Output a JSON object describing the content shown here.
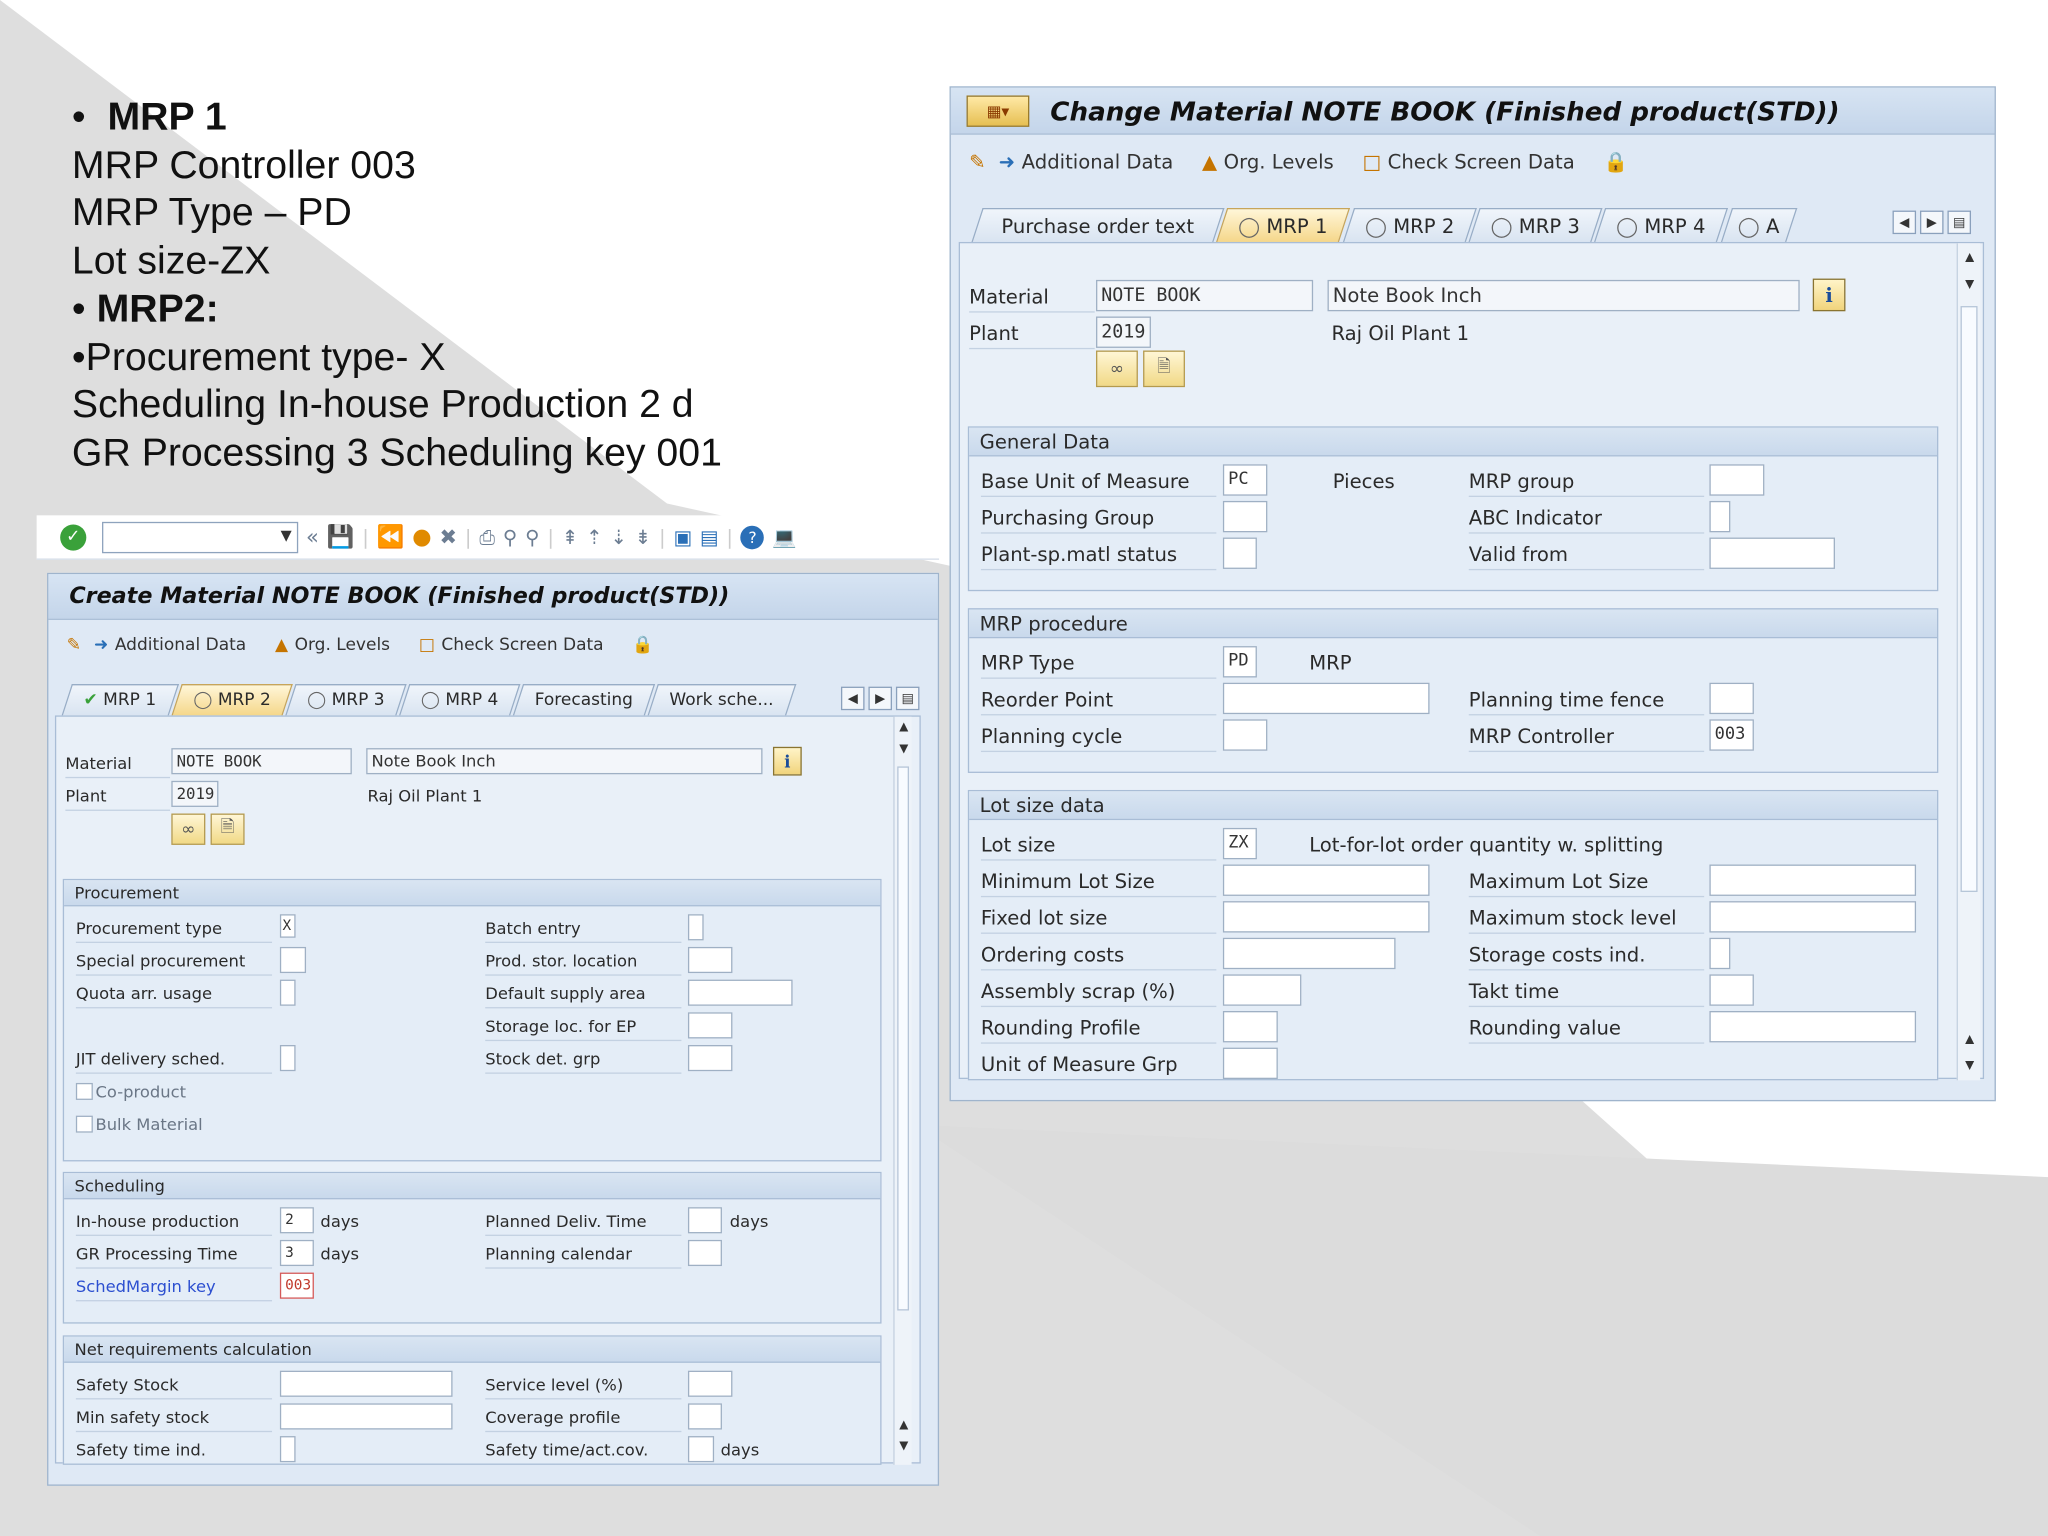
{
  "notes": {
    "line1": "MRP 1",
    "line2": "MRP Controller 003",
    "line3": "MRP Type – PD",
    "line4": "Lot size-ZX",
    "line5": "MRP2:",
    "line6": "•Procurement type- X",
    "line7": "Scheduling In-house Production 2 d",
    "line8": "GR Processing 3 Scheduling key 001"
  },
  "create_window": {
    "title": "Create Material NOTE BOOK (Finished product(STD))",
    "appbar": [
      "Additional Data",
      "Org. Levels",
      "Check Screen Data"
    ],
    "tabs": [
      "MRP 1",
      "MRP 2",
      "MRP 3",
      "MRP 4",
      "Forecasting",
      "Work sche..."
    ],
    "active_tab": "MRP 2",
    "header": {
      "material_label": "Material",
      "material_value": "NOTE BOOK",
      "material_desc": "Note Book Inch",
      "plant_label": "Plant",
      "plant_value": "2019",
      "plant_desc": "Raj Oil Plant 1"
    },
    "procurement": {
      "title": "Procurement",
      "procurement_type_label": "Procurement type",
      "procurement_type_value": "X",
      "special_procurement_label": "Special procurement",
      "quota_label": "Quota arr. usage",
      "jit_label": "JIT delivery sched.",
      "coproduct_label": "Co-product",
      "bulk_label": "Bulk Material",
      "batch_entry_label": "Batch entry",
      "prod_stor_label": "Prod. stor. location",
      "default_supply_label": "Default supply area",
      "storage_ep_label": "Storage loc. for EP",
      "stock_det_label": "Stock det. grp"
    },
    "scheduling": {
      "title": "Scheduling",
      "inhouse_label": "In-house production",
      "inhouse_value": "2",
      "days1": "days",
      "gr_label": "GR Processing Time",
      "gr_value": "3",
      "days2": "days",
      "schedmargin_label": "SchedMargin key",
      "schedmargin_value": "003",
      "planned_deliv_label": "Planned Deliv. Time",
      "days3": "days",
      "planning_cal_label": "Planning calendar"
    },
    "netreq": {
      "title": "Net requirements calculation",
      "safety_stock_label": "Safety Stock",
      "min_safety_label": "Min safety stock",
      "safety_time_label": "Safety time ind.",
      "service_level_label": "Service level (%)",
      "coverage_label": "Coverage profile",
      "safety_time_act_label": "Safety time/act.cov.",
      "days4": "days"
    }
  },
  "change_window": {
    "title": "Change Material NOTE BOOK (Finished product(STD))",
    "appbar": [
      "Additional Data",
      "Org. Levels",
      "Check Screen Data"
    ],
    "tabs": [
      "Purchase order text",
      "MRP 1",
      "MRP 2",
      "MRP 3",
      "MRP 4",
      "A"
    ],
    "active_tab": "MRP 1",
    "header": {
      "material_label": "Material",
      "material_value": "NOTE BOOK",
      "material_desc": "Note Book Inch",
      "plant_label": "Plant",
      "plant_value": "2019",
      "plant_desc": "Raj Oil Plant 1"
    },
    "general": {
      "title": "General Data",
      "base_uom_label": "Base Unit of Measure",
      "base_uom_value": "PC",
      "base_uom_text": "Pieces",
      "purch_group_label": "Purchasing Group",
      "plant_status_label": "Plant-sp.matl status",
      "mrp_group_label": "MRP group",
      "abc_label": "ABC Indicator",
      "valid_from_label": "Valid from"
    },
    "mrp_procedure": {
      "title": "MRP procedure",
      "mrp_type_label": "MRP Type",
      "mrp_type_value": "PD",
      "mrp_type_text": "MRP",
      "reorder_label": "Reorder Point",
      "planning_cycle_label": "Planning cycle",
      "planning_fence_label": "Planning time fence",
      "mrp_controller_label": "MRP Controller",
      "mrp_controller_value": "003"
    },
    "lot_size": {
      "title": "Lot size data",
      "lot_size_label": "Lot size",
      "lot_size_value": "ZX",
      "lot_size_text": "Lot-for-lot order quantity w. splitting",
      "min_lot_label": "Minimum Lot Size",
      "fixed_lot_label": "Fixed lot size",
      "ordering_costs_label": "Ordering costs",
      "assembly_scrap_label": "Assembly scrap (%)",
      "rounding_profile_label": "Rounding Profile",
      "uom_grp_label": "Unit of Measure Grp",
      "max_lot_label": "Maximum Lot Size",
      "max_stock_label": "Maximum stock level",
      "storage_costs_label": "Storage costs ind.",
      "takt_label": "Takt time",
      "rounding_value_label": "Rounding value"
    }
  },
  "colors": {
    "window_bg": "#dfe9f5",
    "title_bg": "#c4d5ea",
    "active_tab": "#f5d78a",
    "link_blue": "#2c4fd0",
    "sched_red": "#c0392b"
  }
}
